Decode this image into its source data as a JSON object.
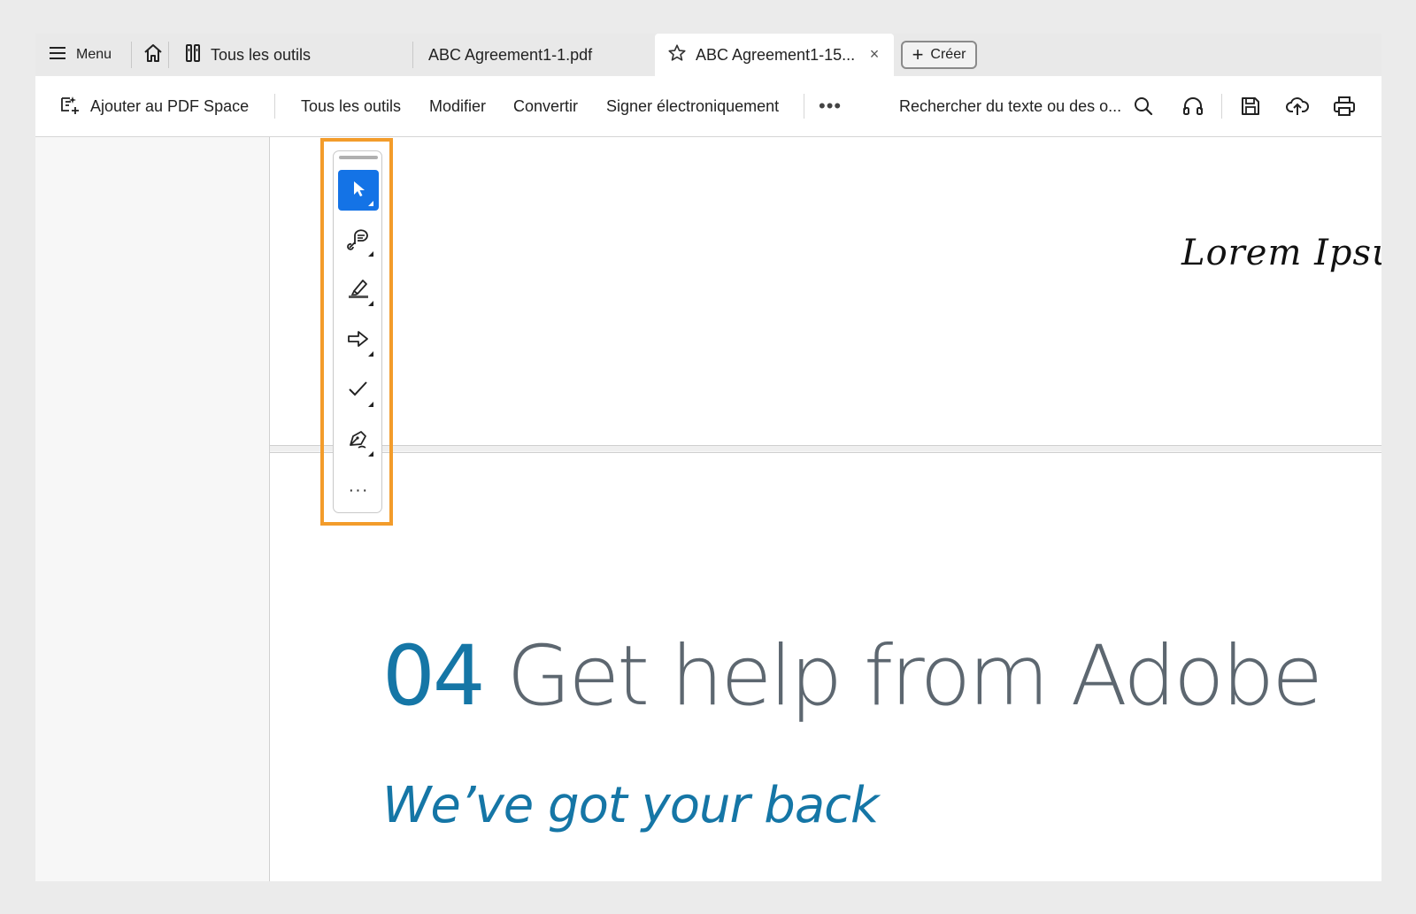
{
  "tabbar": {
    "menu_label": "Menu",
    "tools_tab_label": "Tous les outils",
    "tab1_label": "ABC Agreement1-1.pdf",
    "tab2_label": "ABC Agreement1-15...",
    "close_glyph": "×",
    "create_label": "Créer"
  },
  "toolbar": {
    "add_pdf_space_label": "Ajouter au PDF Space",
    "tools_label": "Tous les outils",
    "modify_label": "Modifier",
    "convert_label": "Convertir",
    "sign_label": "Signer électroniquement",
    "more_glyph": "•••",
    "search_text": "Rechercher du texte ou des o..."
  },
  "document": {
    "signature": "Lorem Ipsum",
    "heading_number": "04",
    "heading_text": " Get help from Adobe",
    "subheading": "We’ve got your back"
  },
  "rail": {
    "more_glyph": "···",
    "tools": [
      "select-icon",
      "comment-icon",
      "highlight-icon",
      "arrow-icon",
      "check-icon",
      "sign-icon"
    ]
  },
  "colors": {
    "accent": "#1473e6",
    "highlight_border": "#f39c2b",
    "doc_blue": "#1576a6",
    "doc_gray": "#5d6770"
  }
}
